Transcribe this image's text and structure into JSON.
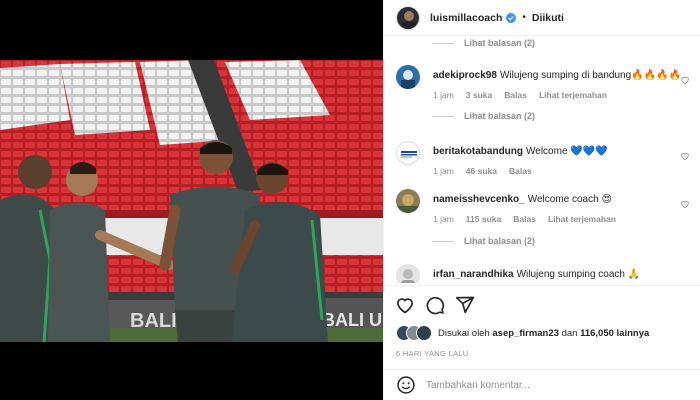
{
  "post": {
    "username": "luismillacoach",
    "follow_label": "Diikuti",
    "separator": "•"
  },
  "comments": {
    "top_view_replies": "Lihat balasan (2)",
    "items": [
      {
        "username": "adekiprock98",
        "text": "Wilujeng sumping di bandung🔥🔥🔥🔥",
        "time": "1 jam",
        "likes": "3 suka",
        "reply": "Balas",
        "translate": "Lihat terjemahan",
        "view_replies": "Lihat balasan (2)"
      },
      {
        "username": "beritakotabandung",
        "text": "Welcome 💙💙💙",
        "time": "1 jam",
        "likes": "46 suka",
        "reply": "Balas"
      },
      {
        "username": "nameisshevcenko_",
        "text": "Welcome coach 😍",
        "time": "1 jam",
        "likes": "115 suka",
        "reply": "Balas",
        "translate": "Lihat terjemahan",
        "view_replies": "Lihat balasan (2)"
      },
      {
        "username": "irfan_narandhika",
        "text": "Wilujeng sumping coach 🙏"
      }
    ]
  },
  "likes": {
    "prefix": "Disukai oleh",
    "user": "asep_firman23",
    "conj": "dan",
    "others": "116,050 lainnya"
  },
  "timestamp": "6 HARI YANG LALU",
  "add_comment": {
    "placeholder": "Tambahkan komentar..."
  },
  "photo": {
    "banner_text": "BALI",
    "banner_text_2": "BALI UNI"
  },
  "colors": {
    "verified": "#3897f0",
    "stadium_seat": "#c8262c",
    "jersey": "#3b4a4a"
  },
  "icons": [
    "verified-badge-icon",
    "heart-icon",
    "comment-icon",
    "share-icon",
    "emoji-icon"
  ]
}
